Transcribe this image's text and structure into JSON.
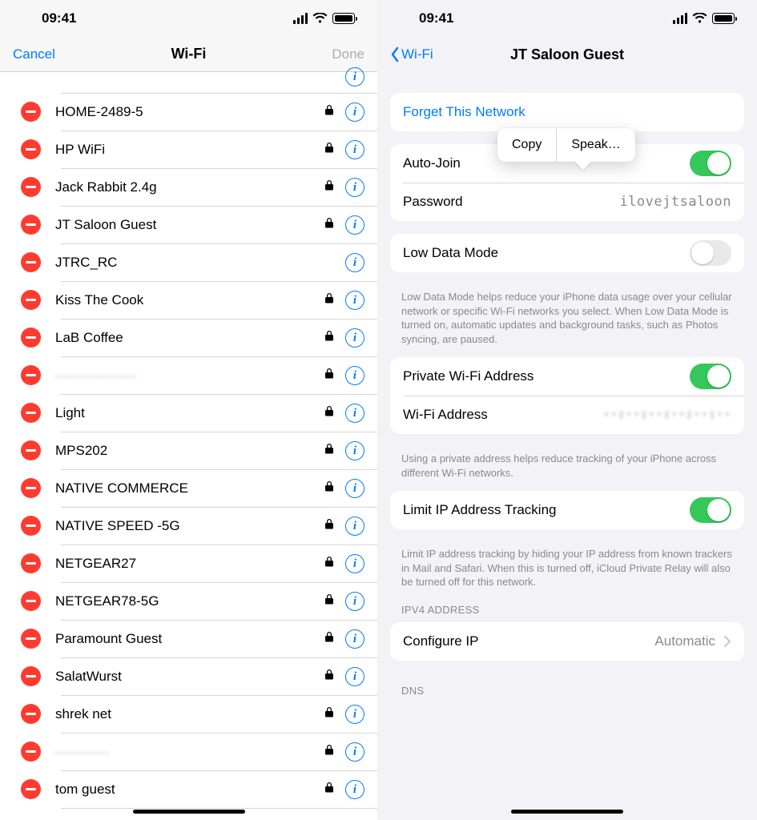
{
  "status_time": "09:41",
  "left": {
    "cancel": "Cancel",
    "title": "Wi-Fi",
    "done": "Done",
    "networks": [
      {
        "name": "HOME-2489-5",
        "locked": true
      },
      {
        "name": "HP WiFi",
        "locked": true
      },
      {
        "name": "Jack Rabbit 2.4g",
        "locked": true
      },
      {
        "name": "JT Saloon Guest",
        "locked": true
      },
      {
        "name": "JTRC_RC",
        "locked": false
      },
      {
        "name": "Kiss The Cook",
        "locked": true
      },
      {
        "name": "LaB Coffee",
        "locked": true
      },
      {
        "name": "··················",
        "locked": true,
        "blur": true
      },
      {
        "name": "Light",
        "locked": true
      },
      {
        "name": "MPS202",
        "locked": true
      },
      {
        "name": "NATIVE COMMERCE",
        "locked": true
      },
      {
        "name": "NATIVE SPEED -5G",
        "locked": true
      },
      {
        "name": "NETGEAR27",
        "locked": true
      },
      {
        "name": "NETGEAR78-5G",
        "locked": true
      },
      {
        "name": "Paramount Guest",
        "locked": true
      },
      {
        "name": "SalatWurst",
        "locked": true
      },
      {
        "name": "shrek net",
        "locked": true
      },
      {
        "name": "············",
        "locked": true,
        "blur": true
      },
      {
        "name": "tom guest",
        "locked": true
      }
    ]
  },
  "right": {
    "back": "Wi-Fi",
    "title": "JT Saloon Guest",
    "forget": "Forget This Network",
    "autojoin": "Auto-Join",
    "password_label": "Password",
    "password_value": "ilovejtsaloon",
    "popover_copy": "Copy",
    "popover_speak": "Speak…",
    "lowdata": "Low Data Mode",
    "lowdata_footer": "Low Data Mode helps reduce your iPhone data usage over your cellular network or specific Wi-Fi networks you select. When Low Data Mode is turned on, automatic updates and background tasks, such as Photos syncing, are paused.",
    "private": "Private Wi-Fi Address",
    "wifiaddr_label": "Wi-Fi Address",
    "wifiaddr_value": "··:··:··:··:··:··",
    "private_footer": "Using a private address helps reduce tracking of your iPhone across different Wi-Fi networks.",
    "limit": "Limit IP Address Tracking",
    "limit_footer": "Limit IP address tracking by hiding your IP address from known trackers in Mail and Safari. When this is turned off, iCloud Private Relay will also be turned off for this network.",
    "ipv4_header": "IPV4 ADDRESS",
    "configure_ip": "Configure IP",
    "configure_ip_value": "Automatic",
    "dns_header": "DNS"
  }
}
